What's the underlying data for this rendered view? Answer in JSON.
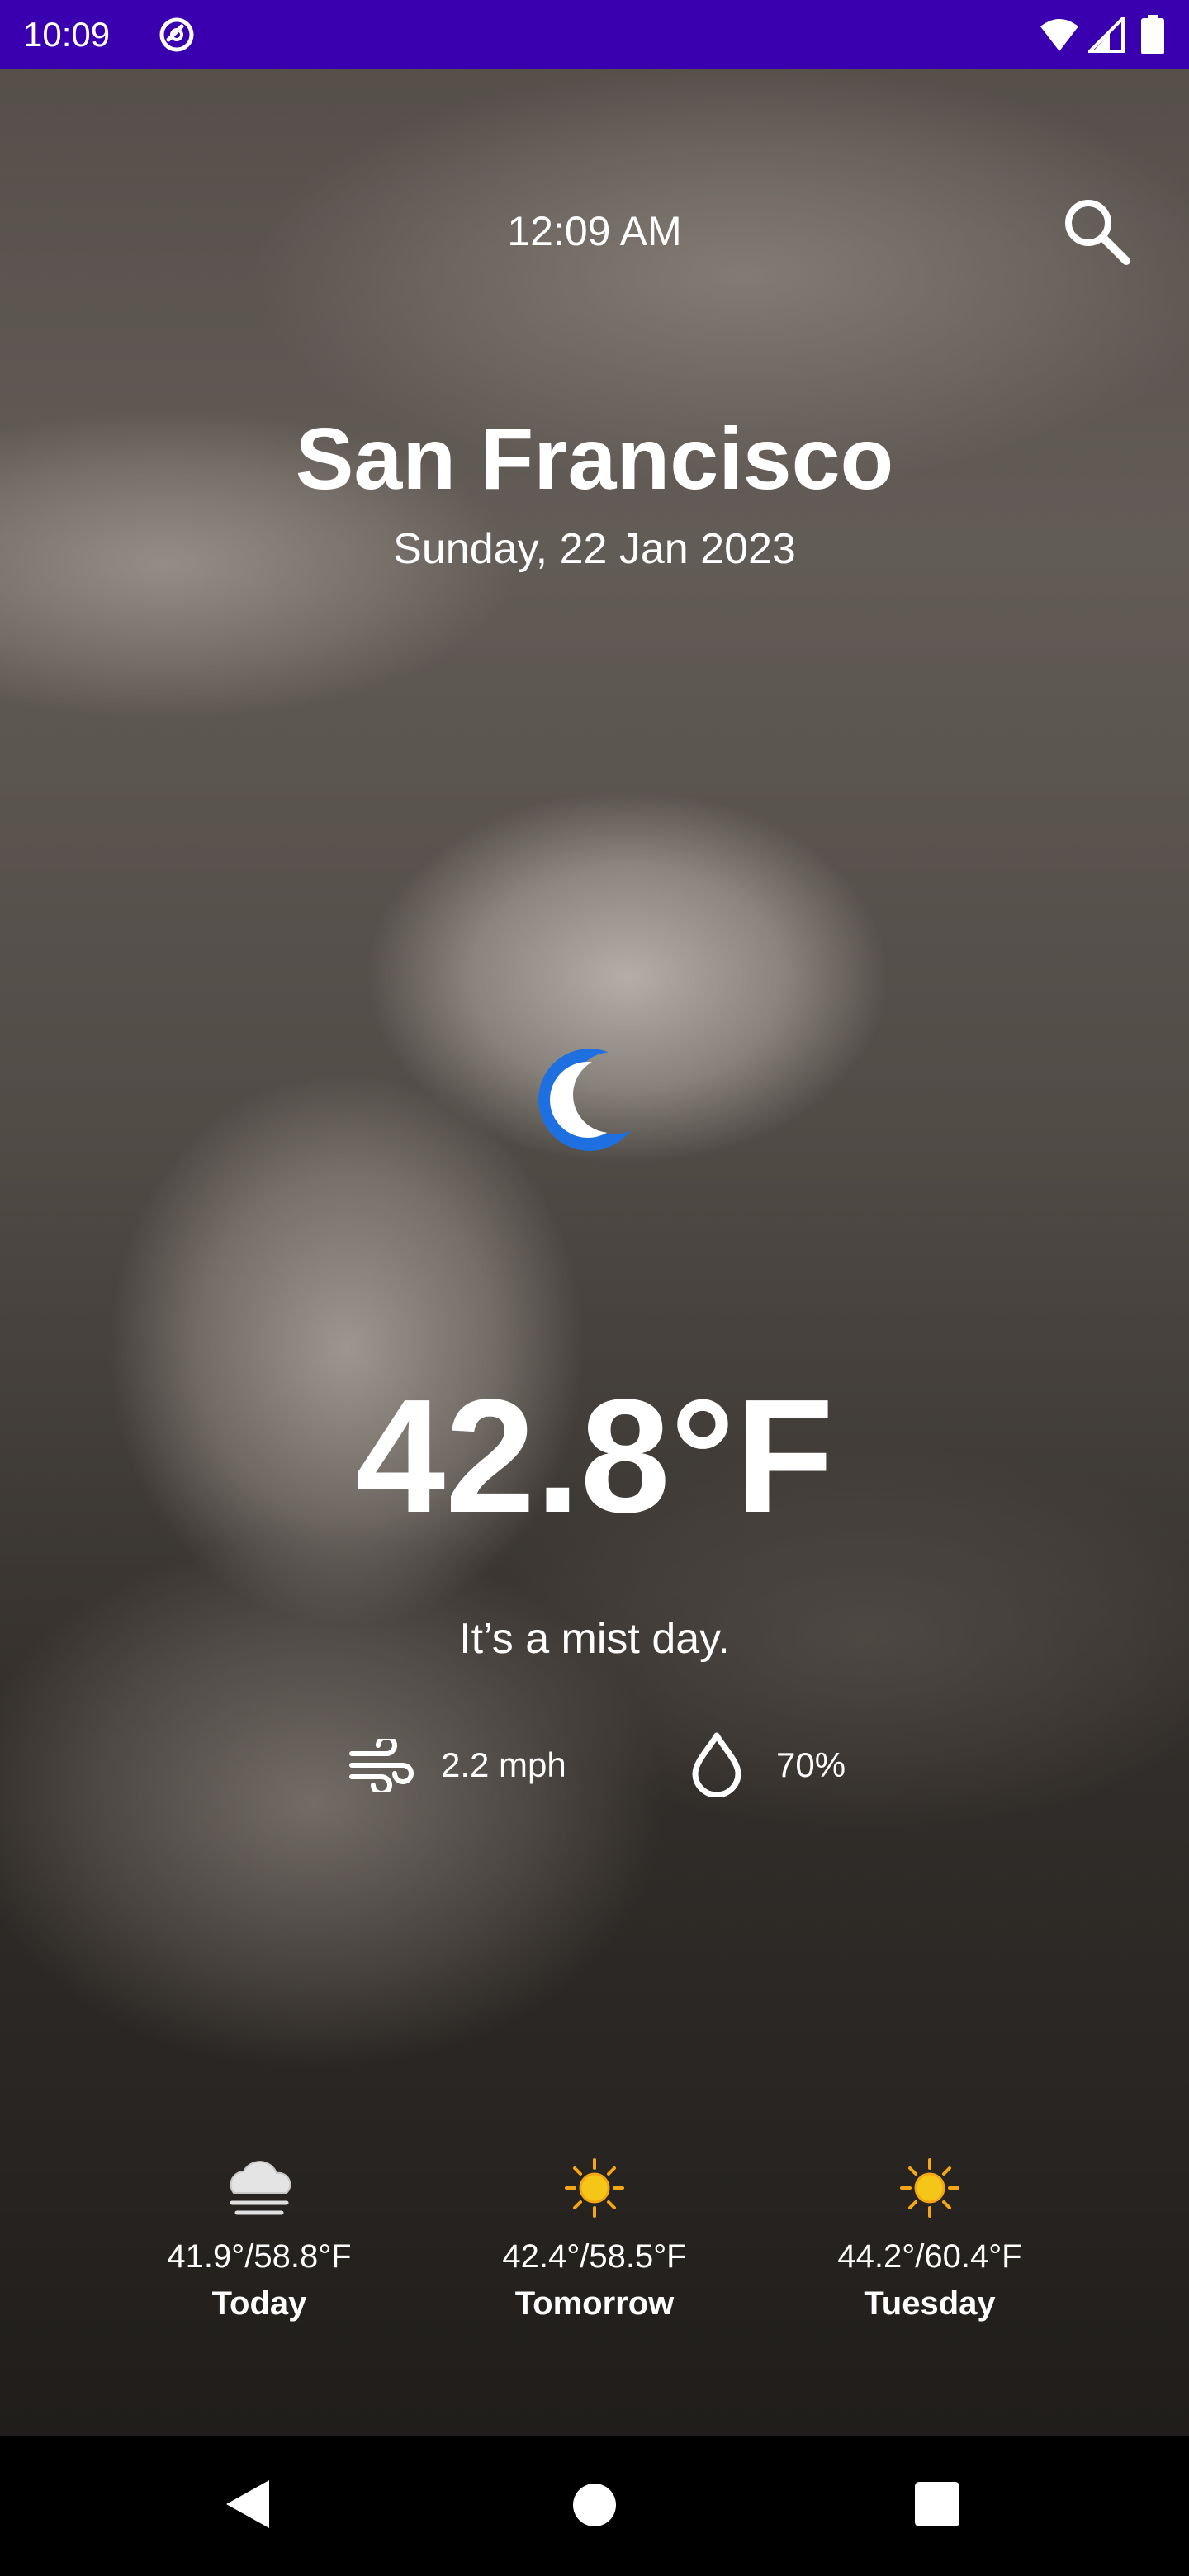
{
  "status_bar": {
    "time": "10:09",
    "icons": [
      "sync-icon",
      "wifi-icon",
      "signal-icon",
      "battery-icon"
    ],
    "background_color": "#3a00b0"
  },
  "header": {
    "local_time": "12:09 AM",
    "search_icon": "search-icon"
  },
  "location": {
    "city": "San Francisco",
    "date": "Sunday, 22 Jan 2023"
  },
  "current": {
    "condition_icon": "moon-icon",
    "icon_color": "#1e6fe0",
    "temperature": "42.8°F",
    "description": "It’s a mist day.",
    "wind_icon": "wind-icon",
    "wind": "2.2 mph",
    "humidity_icon": "water-drop-icon",
    "humidity": "70%"
  },
  "forecast": [
    {
      "icon": "cloud-rain-icon",
      "range": "41.9°/58.8°F",
      "day": "Today"
    },
    {
      "icon": "sun-icon",
      "range": "42.4°/58.5°F",
      "day": "Tomorrow"
    },
    {
      "icon": "sun-icon",
      "range": "44.2°/60.4°F",
      "day": "Tuesday"
    }
  ],
  "sun_color": "#f5c518",
  "nav_bar": {
    "buttons": [
      "back-icon",
      "home-icon",
      "recents-icon"
    ]
  }
}
